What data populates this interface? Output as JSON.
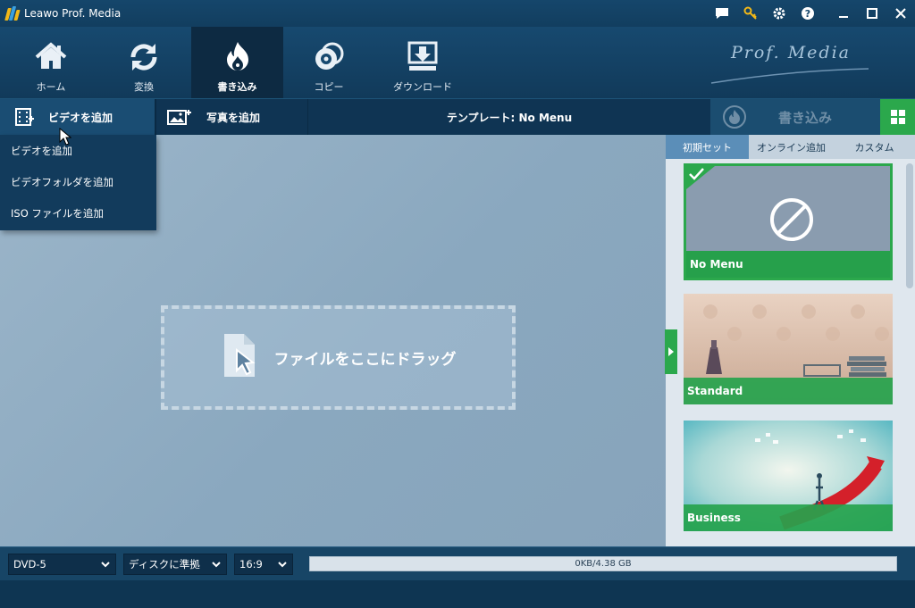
{
  "window": {
    "title": "Leawo Prof. Media",
    "brand": "Prof. Media"
  },
  "nav": {
    "items": [
      {
        "label": "ホーム",
        "icon": "home-icon"
      },
      {
        "label": "変換",
        "icon": "convert-icon"
      },
      {
        "label": "書き込み",
        "icon": "burn-icon",
        "active": true
      },
      {
        "label": "コピー",
        "icon": "copy-disc-icon"
      },
      {
        "label": "ダウンロード",
        "icon": "download-icon"
      }
    ]
  },
  "toolbar": {
    "add_video": "ビデオを追加",
    "add_photo": "写真を追加",
    "template_label": "テンプレート: No Menu",
    "burn_label": "書き込み"
  },
  "dropdown": {
    "items": [
      "ビデオを追加",
      "ビデオフォルダを追加",
      "ISO ファイルを追加"
    ]
  },
  "dropzone": {
    "label": "ファイルをここにドラッグ"
  },
  "right_panel": {
    "tabs": [
      "初期セット",
      "オンライン追加",
      "カスタム"
    ],
    "templates": [
      "No Menu",
      "Standard",
      "Business"
    ]
  },
  "statusbar": {
    "disc_type": "DVD-5",
    "quality": "ディスクに準拠",
    "aspect": "16:9",
    "capacity_text": "0KB/4.38 GB",
    "capacity_fraction": 0.0
  },
  "colors": {
    "accent_green": "#2ba84c",
    "nav_bg": "#17496f",
    "main_bg": "#8fabc2"
  }
}
